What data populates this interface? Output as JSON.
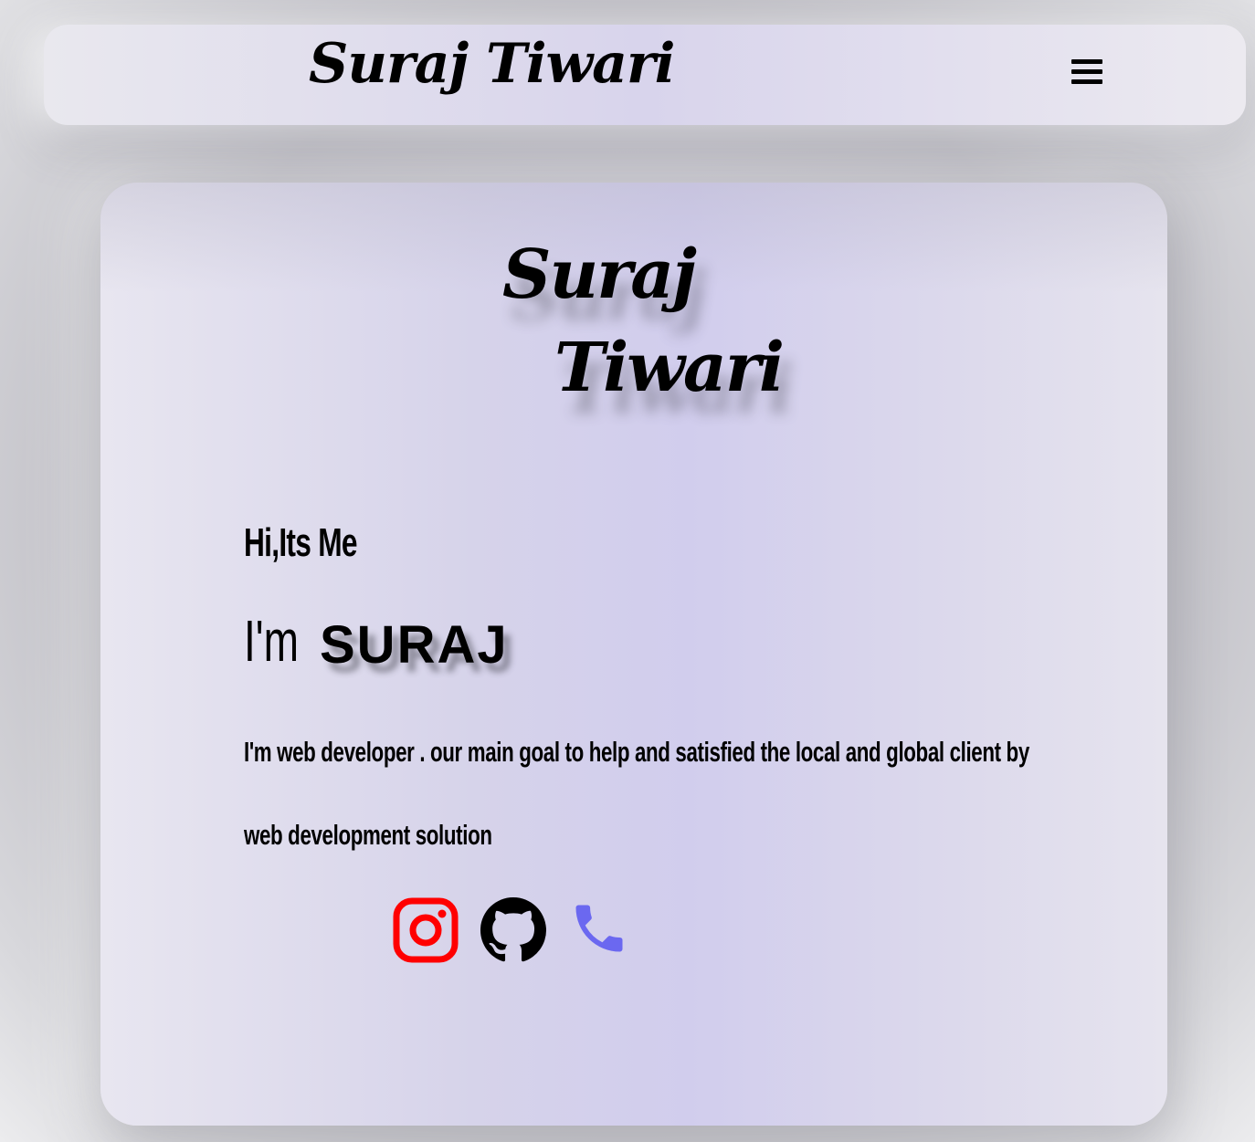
{
  "navbar": {
    "brand": "Suraj Tiwari",
    "menu_icon": "hamburger-menu-icon"
  },
  "hero": {
    "logo_line1": "Suraj",
    "logo_line2": "Tiwari",
    "greeting": "Hi,Its Me",
    "intro_prefix": "I'm",
    "intro_name": "SURAJ",
    "description": "I'm web developer . our main goal to help and satisfied the local and global client by web development solution"
  },
  "social": {
    "links": [
      {
        "icon": "instagram-icon",
        "color": "#ff0000"
      },
      {
        "icon": "github-icon",
        "color": "#000000"
      },
      {
        "icon": "phone-icon",
        "color": "#6b68f0"
      }
    ]
  }
}
